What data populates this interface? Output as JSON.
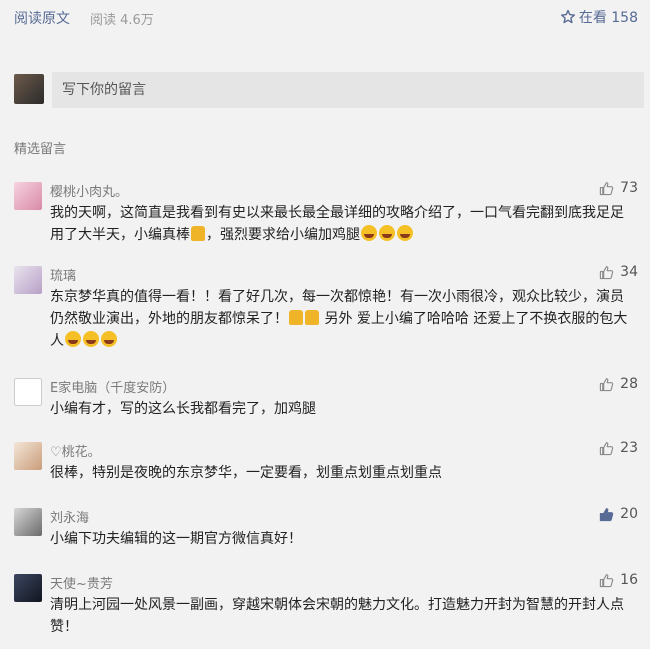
{
  "top_bar": {
    "read_original": "阅读原文",
    "read_count": "阅读 4.6万",
    "wow_label": "在看 158"
  },
  "comment_box": {
    "placeholder": "写下你的留言"
  },
  "section_title": "精选留言",
  "comments": [
    {
      "nick": "樱桃小肉丸。",
      "likes": "73",
      "text_1": "我的天啊，这简直是我看到有史以来最长最全最详细的攻略介绍了，一口气看完翻到底我足足用了大半天，小编真棒",
      "text_2": "，强烈要求给小编加鸡腿",
      "text_3": ""
    },
    {
      "nick": "琉璃",
      "likes": "34",
      "text_1": "东京梦华真的值得一看！！看了好几次，每一次都惊艳！有一次小雨很冷，观众比较少，演员仍然敬业演出，外地的朋友都惊呆了！",
      "text_2": " 另外 爱上小编了哈哈哈 还爱上了不换衣服的包大人",
      "text_3": ""
    },
    {
      "nick": "E家电脑（千度安防）",
      "likes": "28",
      "text_1": "小编有才，写的这么长我都看完了，加鸡腿",
      "text_2": "",
      "text_3": ""
    },
    {
      "nick": "♡桃花。",
      "likes": "23",
      "text_1": "很棒，特别是夜晚的东京梦华，一定要看，划重点划重点划重点",
      "text_2": "",
      "text_3": ""
    },
    {
      "nick": "刘永海",
      "likes": "20",
      "text_1": "小编下功夫编辑的这一期官方微信真好！",
      "text_2": "",
      "text_3": ""
    },
    {
      "nick": "天使~贵芳",
      "likes": "16",
      "text_1": "清明上河园一处风景一副画，穿越宋朝体会宋朝的魅力文化。打造魅力开封为智慧的开封人点赞！",
      "text_2": "",
      "text_3": ""
    }
  ],
  "colors": {
    "link": "#576b95",
    "background": "#f2f2f2",
    "liked_thumb": "#576b95",
    "unliked_thumb": "#8a8a8a"
  },
  "icons": {
    "wow": "wow-star-icon",
    "like": "thumb-up-icon"
  }
}
